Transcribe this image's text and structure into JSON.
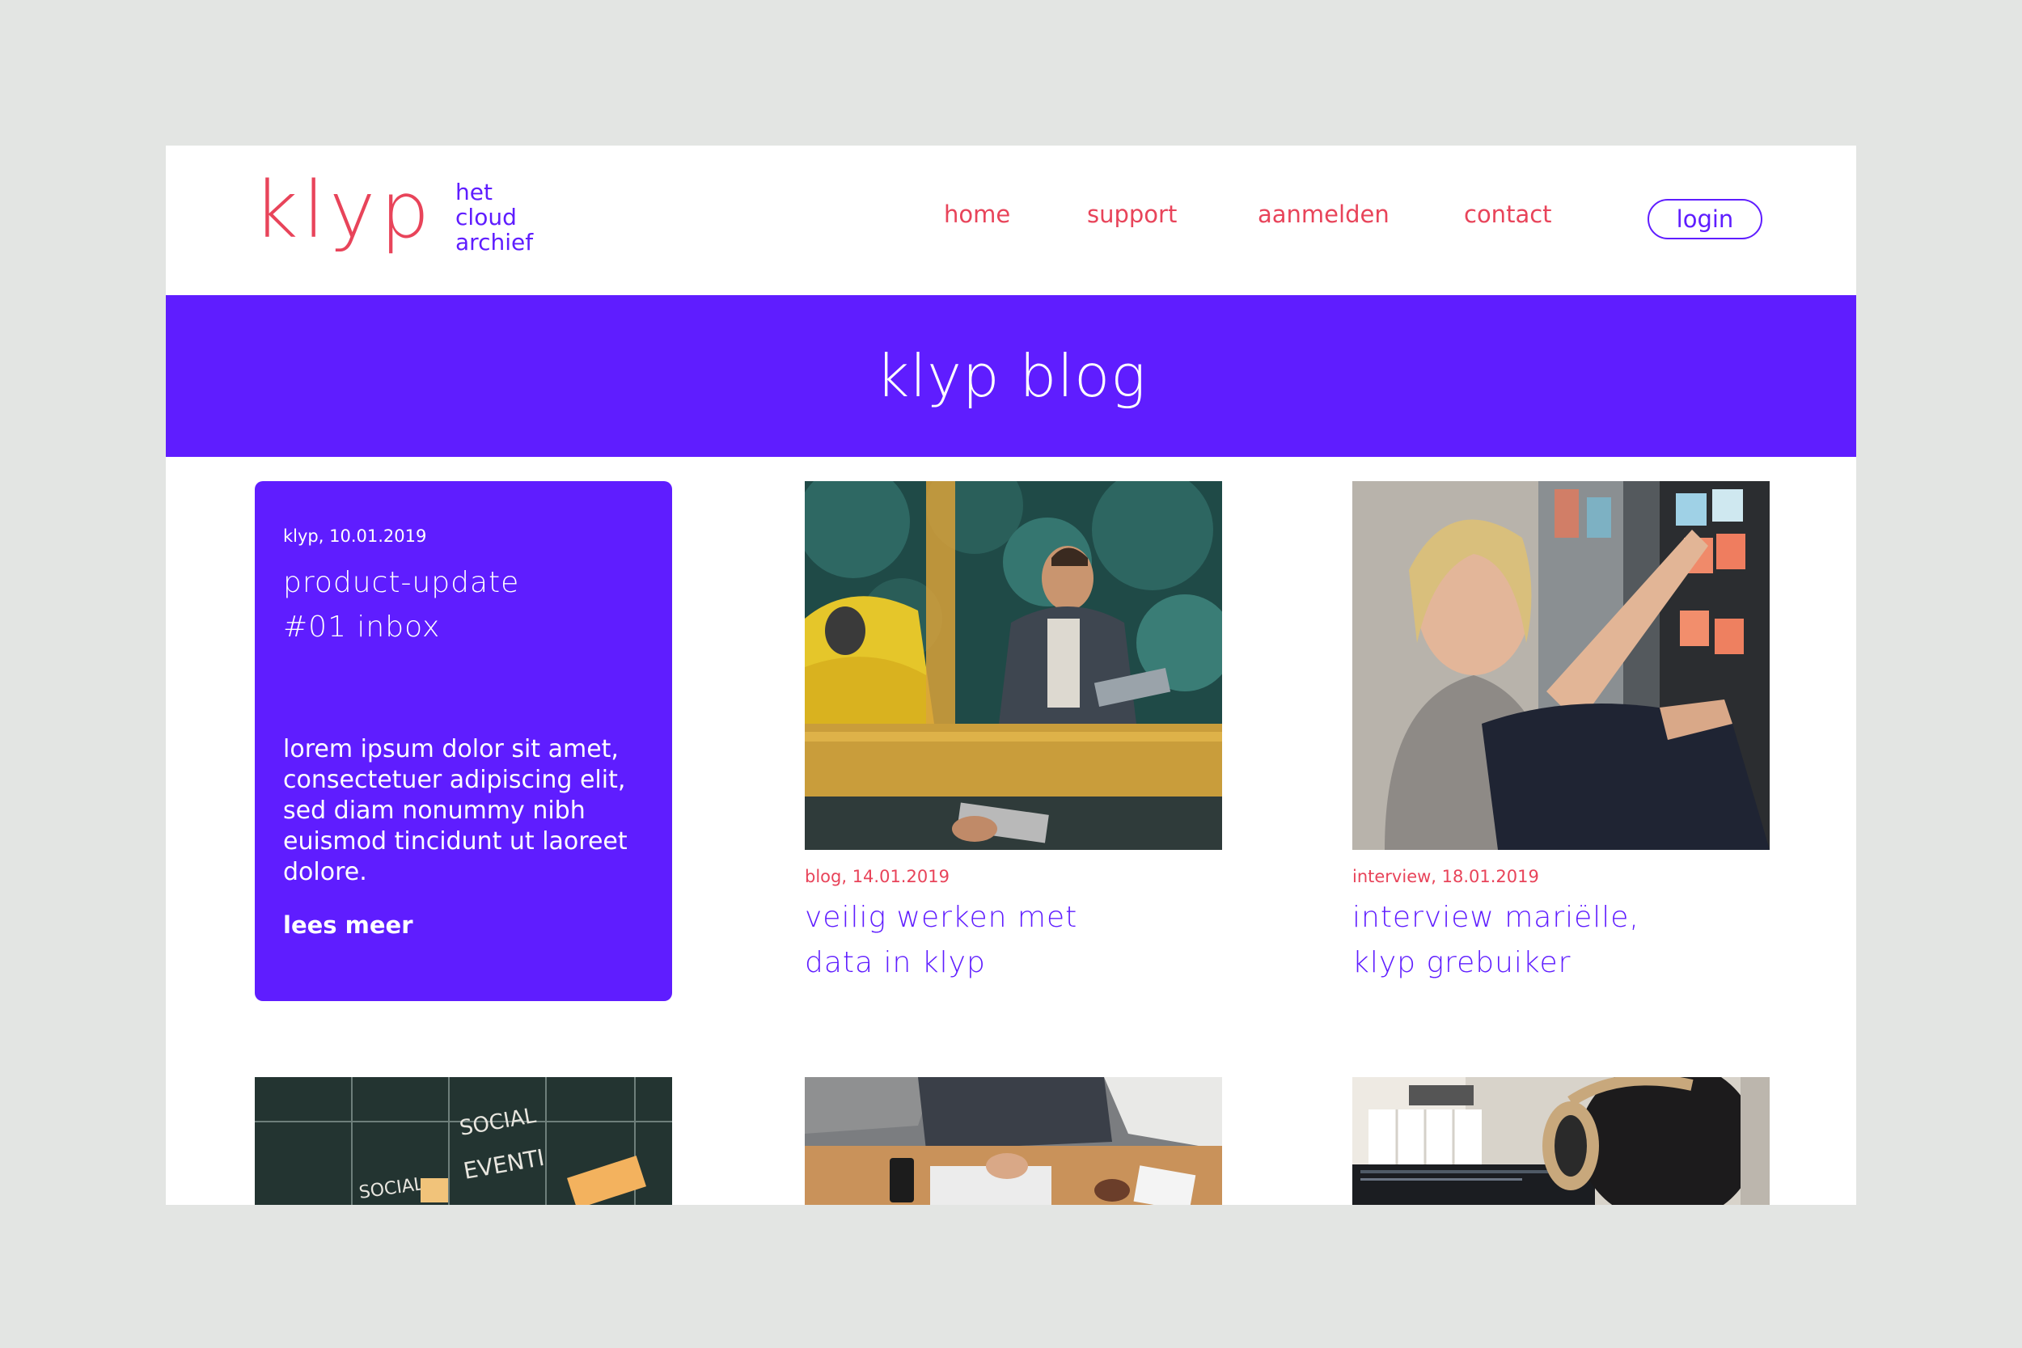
{
  "brand": {
    "name": "klyp",
    "tagline": [
      "het",
      "cloud",
      "archief"
    ],
    "colors": {
      "primary": "#5f1dff",
      "accent": "#e8445a",
      "background": "#e3e5e3"
    }
  },
  "nav": {
    "items": [
      {
        "label": "home"
      },
      {
        "label": "support"
      },
      {
        "label": "aanmelden"
      },
      {
        "label": "contact"
      }
    ],
    "login_label": "login"
  },
  "hero": {
    "title": "klyp blog"
  },
  "featured": {
    "meta": "klyp, 10.01.2019",
    "title_line1": "product-update",
    "title_line2": "#01 inbox",
    "excerpt": "lorem ipsum dolor sit amet, consectetuer adipiscing elit, sed diam nonummy nibh euismod tincidunt ut laoreet dolore.",
    "read_more": "lees meer"
  },
  "posts": [
    {
      "meta": "blog, 14.01.2019",
      "title_line1": "veilig werken met",
      "title_line2": "data in klyp",
      "image": "office-meeting-photo"
    },
    {
      "meta": "interview, 18.01.2019",
      "title_line1": "interview mariëlle,",
      "title_line2": "klyp grebuiker",
      "image": "sticky-notes-photo"
    }
  ],
  "lower_posts": [
    {
      "image": "chalkboard-photo",
      "chalk_text": [
        "SOCIAL",
        "EVENTI",
        "SOCIAL"
      ]
    },
    {
      "image": "desk-laptop-photo"
    },
    {
      "image": "headphones-photo"
    }
  ]
}
